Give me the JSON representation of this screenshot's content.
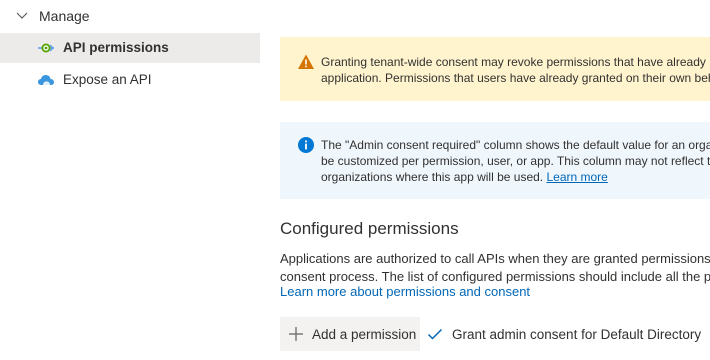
{
  "sidebar": {
    "section_label": "Manage",
    "items": [
      {
        "label": "API permissions",
        "selected": true,
        "icon": "api-permissions-icon"
      },
      {
        "label": "Expose an API",
        "selected": false,
        "icon": "cloud-icon"
      }
    ]
  },
  "warning_banner": {
    "icon": "warning-icon",
    "line1": "Granting tenant-wide consent may revoke permissions that have already b",
    "line2": "application. Permissions that users have already granted on their own beh"
  },
  "info_banner": {
    "icon": "info-icon",
    "line1": "The \"Admin consent required\" column shows the default value for an orga",
    "line2": "be customized per permission, user, or app. This column may not reflect t",
    "line3_prefix": "organizations where this app will be used.",
    "line3_link": "Learn more"
  },
  "configured": {
    "title": "Configured permissions",
    "desc_line1": "Applications are authorized to call APIs when they are granted permissions",
    "desc_line2": "consent process. The list of configured permissions should include all the p",
    "learn_more": "Learn more about permissions and consent"
  },
  "toolbar": {
    "add_label": "Add a permission",
    "grant_label": "Grant admin consent for Default Directory"
  },
  "colors": {
    "accent": "#0067b8",
    "warning_bg": "#fff4ce",
    "warning_icon": "#d47500",
    "info_bg": "#eff6fc",
    "info_icon": "#0078d4",
    "selected_bg": "#edebe9"
  }
}
